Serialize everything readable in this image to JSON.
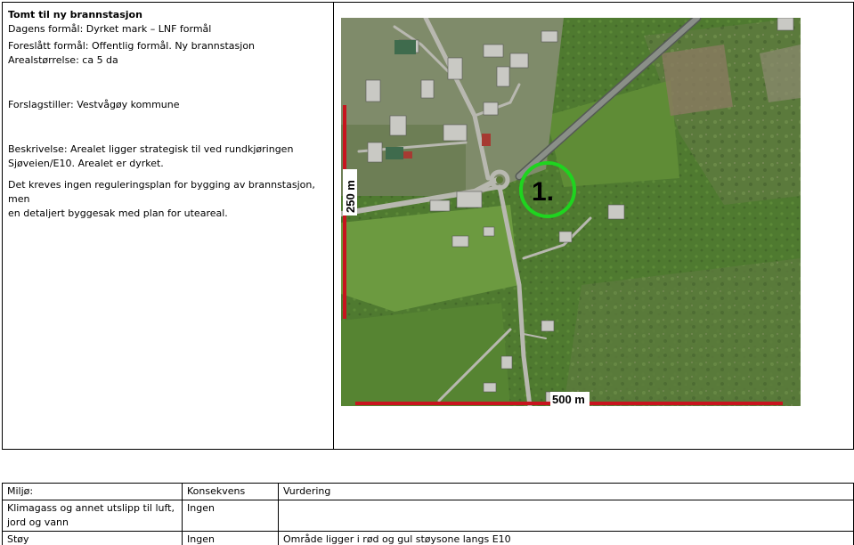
{
  "site": {
    "title": "Tomt til ny brannstasjon",
    "current_use": "Dagens formål: Dyrket mark – LNF formål",
    "proposed_use": "Foreslått formål: Offentlig formål. Ny brannstasjon",
    "area_size": "Arealstørrelse: ca 5 da",
    "proposer": "Forslagstiller: Vestvågøy kommune",
    "description_line1": "Beskrivelse: Arealet ligger strategisk til ved rundkjøringen",
    "description_line2": "Sjøveien/E10. Arealet er dyrket.",
    "requirement_line1": "Det kreves ingen reguleringsplan for bygging av brannstasjon, men",
    "requirement_line2": "en detaljert byggesak med plan for uteareal."
  },
  "map": {
    "site_number": "1.",
    "scale_vertical": "250 m",
    "scale_horizontal": "500 m",
    "marker_color": "#1fd41f",
    "scale_color": "#c8141e"
  },
  "assessment": {
    "headers": [
      "Miljø:",
      "Konsekvens",
      "Vurdering"
    ],
    "rows": [
      {
        "topic": "Klimagass og annet utslipp til luft, jord og vann",
        "consequence": "Ingen",
        "evaluation": ""
      },
      {
        "topic": "Støy",
        "consequence": "Ingen",
        "evaluation": "Område ligger i rød og gul støysone langs E10"
      }
    ]
  }
}
